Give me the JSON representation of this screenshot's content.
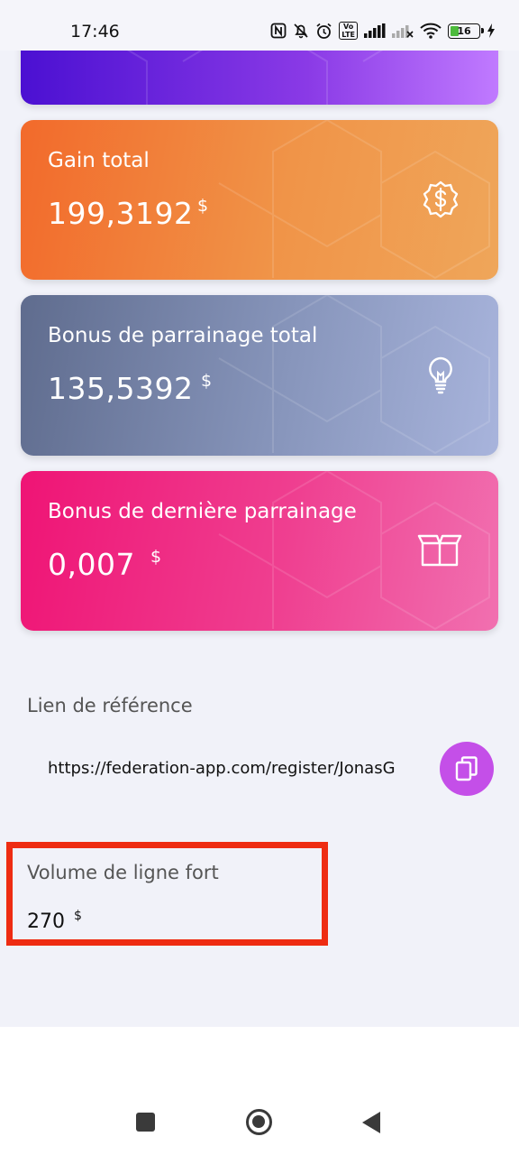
{
  "status_bar": {
    "time": "17:46",
    "volte_label": "Vo\nLTE",
    "battery_level": "16",
    "icons": [
      "nfc-icon",
      "bell-off-icon",
      "alarm-icon",
      "volte-icon",
      "signal-icon",
      "signal-off-icon",
      "wifi-icon",
      "battery-icon",
      "charging-icon"
    ]
  },
  "cards": {
    "gain": {
      "title": "Gain total",
      "value": "199,3192",
      "currency": "$",
      "icon": "dollar-badge-icon"
    },
    "bonus": {
      "title": "Bonus de parrainage total",
      "value": "135,5392",
      "currency": "$",
      "icon": "lightbulb-icon"
    },
    "last": {
      "title": "Bonus de dernière parrainage",
      "value": "0,007",
      "currency": "$",
      "icon": "box-icon"
    }
  },
  "referral": {
    "label": "Lien de référence",
    "link": "https://federation-app.com/register/JonasG",
    "copy_icon": "copy-icon"
  },
  "volume": {
    "label": "Volume de ligne fort",
    "value": "270",
    "currency": "$"
  },
  "colors": {
    "gain_gradient": [
      "#f26a2b",
      "#efa65a"
    ],
    "bonus_gradient": [
      "#5f6c8e",
      "#a8b4dc"
    ],
    "last_gradient": [
      "#ef1475",
      "#f170b0"
    ],
    "copy_button": "#c44fe8",
    "highlight_border": "#ee2c12"
  },
  "nav": {
    "icons": [
      "recent-apps-icon",
      "home-icon",
      "back-icon"
    ]
  }
}
